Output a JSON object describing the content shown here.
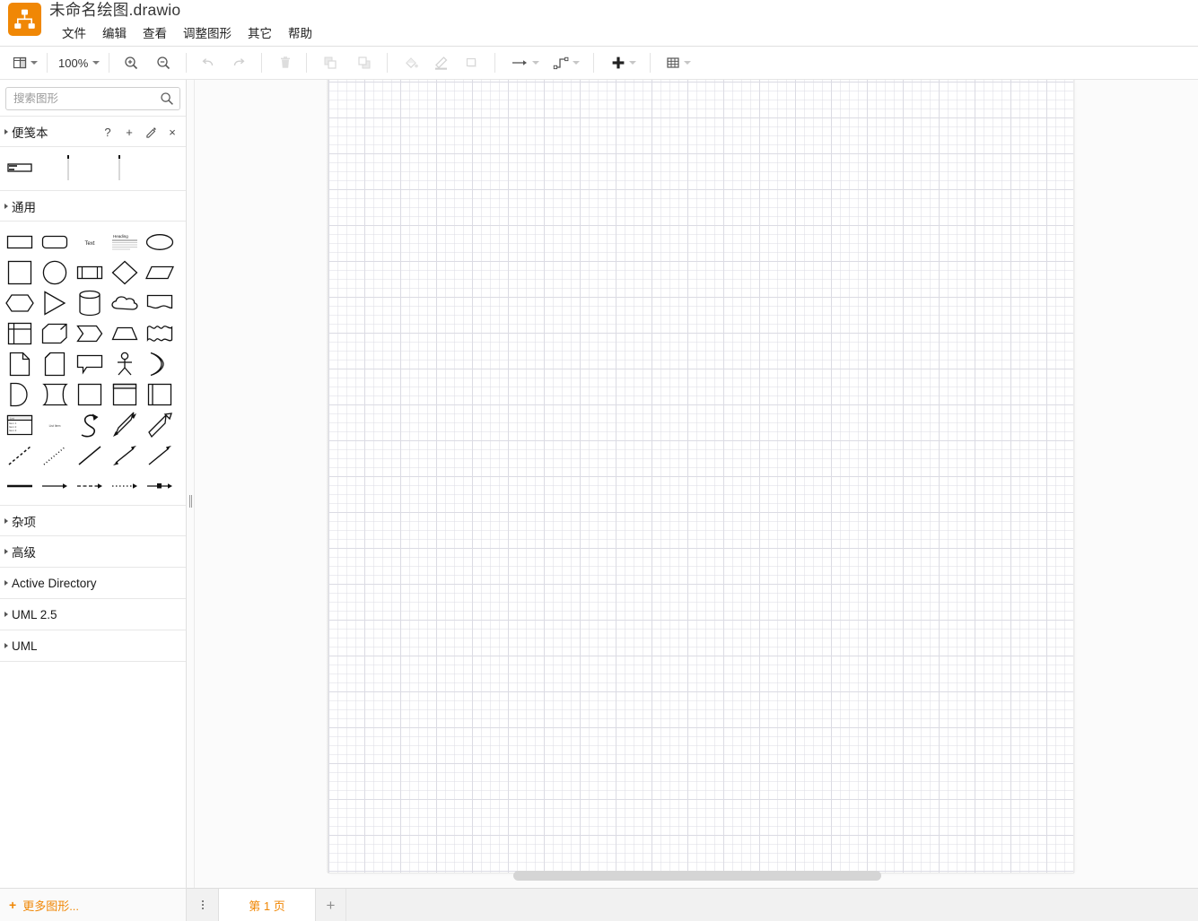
{
  "app": {
    "logo_icon": "drawio-logo-icon",
    "title": "未命名绘图.drawio"
  },
  "menubar": {
    "items": [
      {
        "label": "文件",
        "name": "menu-file"
      },
      {
        "label": "编辑",
        "name": "menu-edit"
      },
      {
        "label": "查看",
        "name": "menu-view"
      },
      {
        "label": "调整图形",
        "name": "menu-arrange"
      },
      {
        "label": "其它",
        "name": "menu-extras"
      },
      {
        "label": "帮助",
        "name": "menu-help"
      }
    ]
  },
  "toolbar": {
    "view_icon": "panel-layout-icon",
    "zoom_value": "100%",
    "zoom_in_icon": "zoom-in-icon",
    "zoom_out_icon": "zoom-out-icon",
    "undo_icon": "undo-icon",
    "redo_icon": "redo-icon",
    "delete_icon": "trash-icon",
    "to_front_icon": "bring-to-front-icon",
    "to_back_icon": "send-to-back-icon",
    "fill_color_icon": "fill-bucket-icon",
    "line_color_icon": "line-color-pen-icon",
    "shadow_icon": "shadow-square-icon",
    "waypoints_icon": "arrow-style-icon",
    "edge_style_icon": "edge-waypoint-icon",
    "insert_icon": "plus-icon",
    "table_icon": "table-grid-icon"
  },
  "sidebar": {
    "search": {
      "placeholder": "搜索图形",
      "value": "",
      "icon": "search-icon"
    },
    "scratchpad": {
      "title": "便笺本",
      "tools": [
        {
          "glyph": "?",
          "name": "scratchpad-help-icon"
        },
        {
          "glyph": "+",
          "name": "scratchpad-add-icon"
        },
        {
          "glyph": "pencil",
          "name": "scratchpad-edit-icon"
        },
        {
          "glyph": "×",
          "name": "scratchpad-close-icon"
        }
      ],
      "shapes": [
        {
          "name": "shape-note-rect",
          "icon": "note-rectangle-icon"
        },
        {
          "name": "shape-vertical-line-1",
          "icon": "vertical-line-icon"
        },
        {
          "name": "shape-vertical-line-2",
          "icon": "vertical-line-icon"
        }
      ]
    },
    "general": {
      "title": "通用",
      "shapes": [
        [
          "rectangle",
          "rounded-rectangle",
          "text",
          "textbox",
          "ellipse"
        ],
        [
          "square",
          "circle",
          "process",
          "rhombus",
          "parallelogram"
        ],
        [
          "hexagon",
          "triangle",
          "cylinder",
          "cloud",
          "document"
        ],
        [
          "internal-storage",
          "cube",
          "step",
          "trapezoid",
          "tape"
        ],
        [
          "note",
          "note2",
          "callout",
          "actor",
          "or"
        ],
        [
          "and",
          "data-storage",
          "container",
          "vertical-container",
          "horizontal-pool"
        ],
        [
          "list",
          "list-item",
          "curve-arrow",
          "bidirectional-arrow",
          "arrow"
        ],
        [
          "dashed-line",
          "dotted-line",
          "line",
          "bidirectional-connector",
          "directional-connector"
        ],
        [
          "link",
          "arrow-connector",
          "dashed-arrow-connector",
          "dotted-arrow-connector",
          "labelled-connector"
        ]
      ]
    },
    "sections": [
      {
        "label": "杂项",
        "name": "section-misc"
      },
      {
        "label": "高级",
        "name": "section-advanced"
      },
      {
        "label": "Active Directory",
        "name": "section-active-directory"
      },
      {
        "label": "UML 2.5",
        "name": "section-uml-25"
      },
      {
        "label": "UML",
        "name": "section-uml"
      }
    ],
    "more_shapes": {
      "label": "更多图形...",
      "plus": "+"
    }
  },
  "tabbar": {
    "menu_icon": "page-menu-dots-icon",
    "pages": [
      {
        "label": "第 1 页",
        "active": true
      }
    ],
    "add_label": "+"
  },
  "colors": {
    "accent": "#f08705",
    "toolbar_border": "#e0e0e0",
    "canvas_bg": "#fbfbfb",
    "page_bg": "#ffffff",
    "grid_minor": "#dedee6",
    "grid_major": "#d0d0da",
    "tabbar_bg": "#f1f1f1"
  }
}
